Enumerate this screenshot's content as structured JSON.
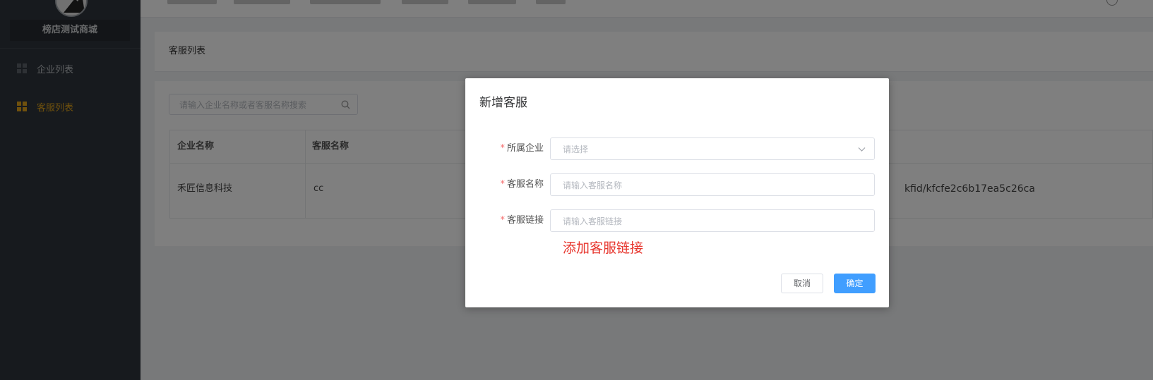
{
  "sidebar": {
    "store_name": "榜店测试商城",
    "items": [
      {
        "label": "企业列表",
        "icon": "grid-icon",
        "active": false
      },
      {
        "label": "客服列表",
        "icon": "grid-icon",
        "active": true
      }
    ]
  },
  "page": {
    "title": "客服列表",
    "search_placeholder": "请输入企业名称或者客服名称搜索"
  },
  "table": {
    "headers": [
      "企业名称",
      "客服名称"
    ],
    "rows": [
      {
        "company": "禾匠信息科技",
        "agent": "cc",
        "link_fragment": "kfid/kfcfe2c6b17ea5c26ca"
      }
    ]
  },
  "dialog": {
    "title": "新增客服",
    "fields": {
      "company": {
        "label": "所属企业",
        "placeholder": "请选择",
        "value": ""
      },
      "name": {
        "label": "客服名称",
        "placeholder": "请输入客服名称",
        "value": ""
      },
      "link": {
        "label": "客服链接",
        "placeholder": "请输入客服链接",
        "value": ""
      }
    },
    "hint": "添加客服链接",
    "cancel_label": "取消",
    "confirm_label": "确定"
  },
  "colors": {
    "sidebar_bg": "#2f353c",
    "accent": "#e0a31a",
    "primary": "#409eff",
    "required": "#f56c6c",
    "hint": "#e7362e"
  }
}
